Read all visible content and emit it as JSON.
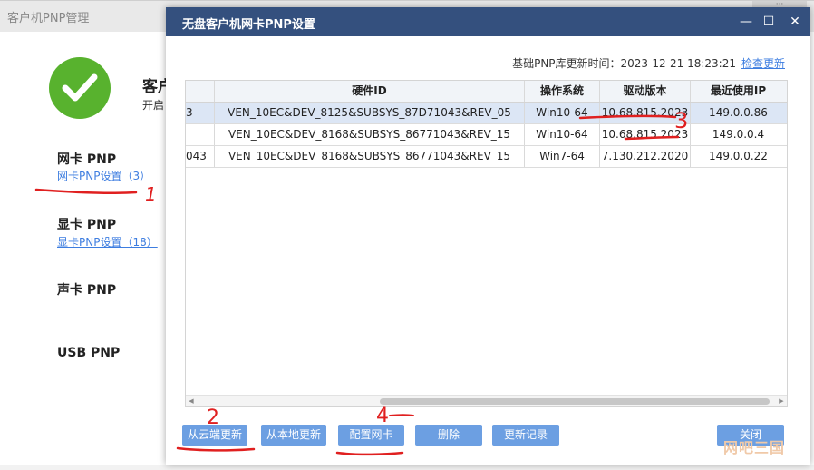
{
  "background": {
    "title": "客户机PNP管理",
    "topright_text": "···",
    "heading": "客户",
    "subtext": "开启",
    "sections": [
      {
        "title": "网卡 PNP",
        "link": "网卡PNP设置（3）"
      },
      {
        "title": "显卡 PNP",
        "link": "显卡PNP设置（18）"
      },
      {
        "title": "声卡 PNP",
        "link": ""
      },
      {
        "title": "USB PNP",
        "link": ""
      }
    ]
  },
  "dialog": {
    "title": "无盘客户机网卡PNP设置",
    "window_controls": [
      "—",
      "☐",
      "✕"
    ],
    "update_label": "基础PNP库更新时间：2023-12-21 18:23:21",
    "check_update_link": "检查更新",
    "table": {
      "headers": [
        "",
        "硬件ID",
        "操作系统",
        "驱动版本",
        "最近使用IP"
      ],
      "rows": [
        [
          "3",
          "VEN_10EC&DEV_8125&SUBSYS_87D71043&REV_05",
          "Win10-64",
          "10.68.815.2023",
          "149.0.0.86"
        ],
        [
          "",
          "VEN_10EC&DEV_8168&SUBSYS_86771043&REV_15",
          "Win10-64",
          "10.68.815.2023",
          "149.0.0.4"
        ],
        [
          "043",
          "VEN_10EC&DEV_8168&SUBSYS_86771043&REV_15",
          "Win7-64",
          "7.130.212.2020",
          "149.0.0.22"
        ]
      ],
      "selected_row": 0
    },
    "buttons": [
      "从云端更新",
      "从本地更新",
      "配置网卡",
      "删除",
      "更新记录"
    ],
    "close_button": "关闭",
    "watermark": "网吧三国"
  },
  "annotations": [
    "1",
    "2",
    "3",
    "4"
  ],
  "colors": {
    "titlebar": "#34507e",
    "button": "#6c9fe2",
    "link": "#3d7de0",
    "check_green": "#58b22e",
    "annotation_red": "#e02020"
  }
}
